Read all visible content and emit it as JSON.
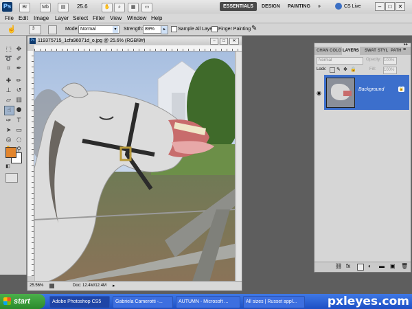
{
  "app": {
    "logo": "Ps",
    "buttons": [
      "Br",
      "Mb"
    ],
    "zoom": "25.6",
    "workspaces": [
      "ESSENTIALS",
      "DESIGN",
      "PAINTING"
    ],
    "more": "»",
    "cs_live": "CS Live",
    "window_controls": [
      "–",
      "□",
      "✕"
    ]
  },
  "menu": [
    "File",
    "Edit",
    "Image",
    "Layer",
    "Select",
    "Filter",
    "View",
    "Window",
    "Help"
  ],
  "options": {
    "brush_size": "3",
    "mode_label": "Mode:",
    "mode_value": "Normal",
    "strength_label": "Strength:",
    "strength_value": "89%",
    "sample_all": "Sample All Layers",
    "finger": "Finger Painting"
  },
  "document": {
    "title": "119375715_1cfa96071d_o.jpg @ 25.6% (RGB/8#)",
    "zoom": "25.56%",
    "doc_size": "Doc: 12.4M/12.4M"
  },
  "panel": {
    "tabs": [
      "CHAN",
      "COLO",
      "LAYERS",
      "SWAT",
      "STYL",
      "PATH"
    ],
    "active_tab": "LAYERS",
    "blend_mode": "Normal",
    "opacity_label": "Opacity:",
    "opacity_value": "100%",
    "lock_label": "Lock:",
    "fill_label": "Fill:",
    "fill_value": "100%",
    "layer_name": "Background"
  },
  "taskbar": {
    "start": "start",
    "items": [
      "Adobe Photoshop CS5",
      "Gabriela Camerotti -...",
      "AUTUMN - Microsoft ...",
      "All sizes | Russet appl..."
    ],
    "watermark": "pxleyes.com"
  },
  "colors": {
    "foreground": "#e2852d",
    "background": "#ffffff",
    "layer_selected": "#3c6fcc",
    "taskbar": "#2457d6"
  }
}
